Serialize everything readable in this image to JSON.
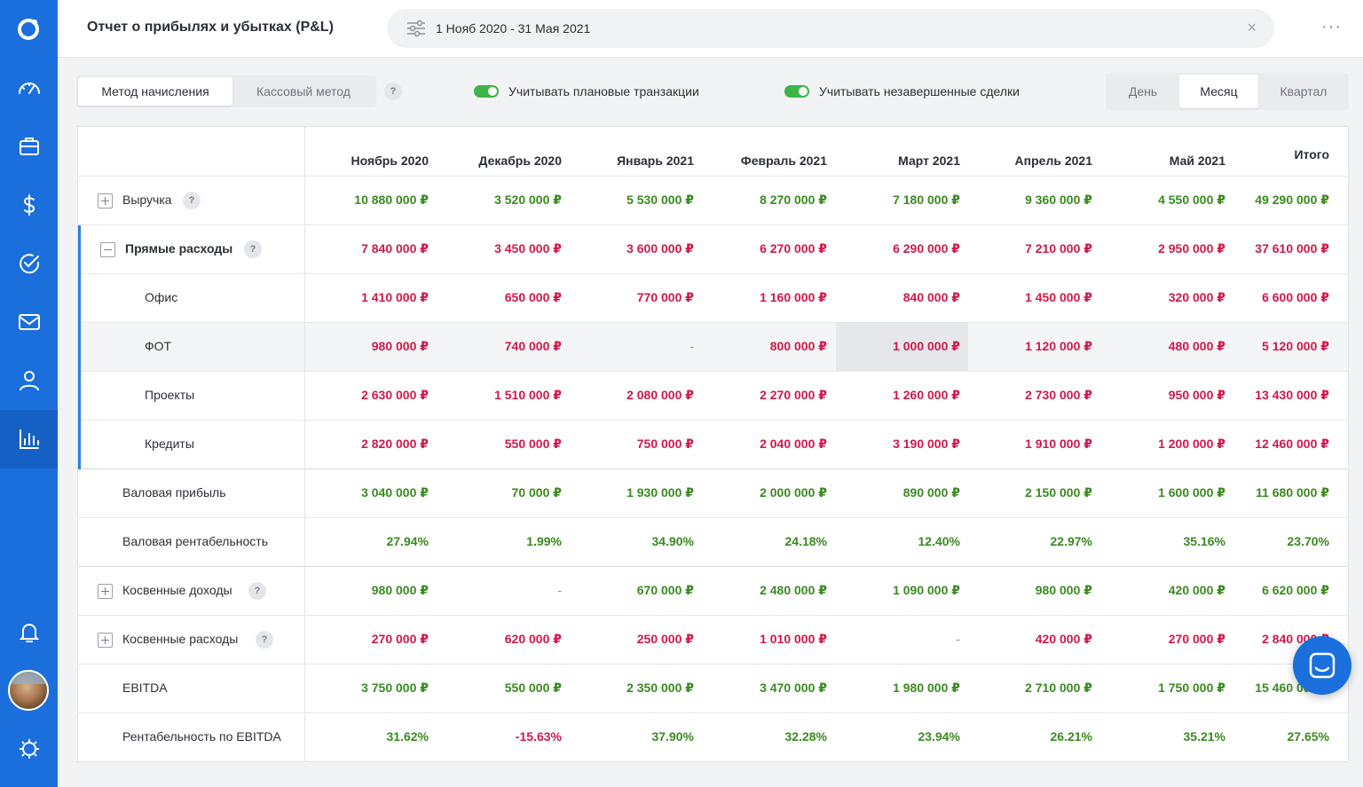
{
  "header": {
    "title": "Отчет о прибылях и убытках (P&L)",
    "date_range": "1 Нояб 2020 - 31 Мая 2021",
    "clear_icon": "×",
    "more_icon": "···"
  },
  "toolbar": {
    "method_accrual": "Метод начисления",
    "method_cash": "Кассовый метод",
    "help": "?",
    "toggle_planned": "Учитывать плановые транзакции",
    "toggle_unfinished": "Учитывать незавершенные сделки",
    "period_day": "День",
    "period_month": "Месяц",
    "period_quarter": "Квартал"
  },
  "colors": {
    "sidebar": "#1a6fdc",
    "positive": "#3a8a1f",
    "negative": "#d1184a",
    "toggle_on": "#3bb54a",
    "accent": "#2f7ee6"
  },
  "sidebar_icons": [
    "logo-icon",
    "dashboard-icon",
    "briefcase-icon",
    "dollar-icon",
    "check-circle-icon",
    "mail-icon",
    "user-icon",
    "chart-icon",
    "bell-icon",
    "avatar",
    "settings-icon"
  ],
  "table": {
    "columns": [
      "Ноябрь 2020",
      "Декабрь 2020",
      "Январь 2021",
      "Февраль 2021",
      "Март 2021",
      "Апрель 2021",
      "Май 2021",
      "Итого"
    ],
    "rows": [
      {
        "label": "Выручка",
        "values": [
          "10 880 000 ₽",
          "3 520 000 ₽",
          "5 530 000 ₽",
          "8 270 000 ₽",
          "7 180 000 ₽",
          "9 360 000 ₽",
          "4 550 000 ₽",
          "49 290 000 ₽"
        ]
      },
      {
        "label": "Прямые расходы",
        "values": [
          "7 840 000 ₽",
          "3 450 000 ₽",
          "3 600 000 ₽",
          "6 270 000 ₽",
          "6 290 000 ₽",
          "7 210 000 ₽",
          "2 950 000 ₽",
          "37 610 000 ₽"
        ]
      },
      {
        "label": "Офис",
        "values": [
          "1 410 000 ₽",
          "650 000 ₽",
          "770 000 ₽",
          "1 160 000 ₽",
          "840 000 ₽",
          "1 450 000 ₽",
          "320 000 ₽",
          "6 600 000 ₽"
        ]
      },
      {
        "label": "ФОТ",
        "values": [
          "980 000 ₽",
          "740 000 ₽",
          "-",
          "800 000 ₽",
          "1 000 000 ₽",
          "1 120 000 ₽",
          "480 000 ₽",
          "5 120 000 ₽"
        ]
      },
      {
        "label": "Проекты",
        "values": [
          "2 630 000 ₽",
          "1 510 000 ₽",
          "2 080 000 ₽",
          "2 270 000 ₽",
          "1 260 000 ₽",
          "2 730 000 ₽",
          "950 000 ₽",
          "13 430 000 ₽"
        ]
      },
      {
        "label": "Кредиты",
        "values": [
          "2 820 000 ₽",
          "550 000 ₽",
          "750 000 ₽",
          "2 040 000 ₽",
          "3 190 000 ₽",
          "1 910 000 ₽",
          "1 200 000 ₽",
          "12 460 000 ₽"
        ]
      },
      {
        "label": "Валовая прибыль",
        "values": [
          "3 040 000 ₽",
          "70 000 ₽",
          "1 930 000 ₽",
          "2 000 000 ₽",
          "890 000 ₽",
          "2 150 000 ₽",
          "1 600 000 ₽",
          "11 680 000 ₽"
        ]
      },
      {
        "label": "Валовая рентабельность",
        "values": [
          "27.94%",
          "1.99%",
          "34.90%",
          "24.18%",
          "12.40%",
          "22.97%",
          "35.16%",
          "23.70%"
        ]
      },
      {
        "label": "Косвенные доходы",
        "values": [
          "980 000 ₽",
          "-",
          "670 000 ₽",
          "2 480 000 ₽",
          "1 090 000 ₽",
          "980 000 ₽",
          "420 000 ₽",
          "6 620 000 ₽"
        ]
      },
      {
        "label": "Косвенные расходы",
        "values": [
          "270 000 ₽",
          "620 000 ₽",
          "250 000 ₽",
          "1 010 000 ₽",
          "-",
          "420 000 ₽",
          "270 000 ₽",
          "2 840 000 ₽"
        ]
      },
      {
        "label": "EBITDA",
        "values": [
          "3 750 000 ₽",
          "550 000 ₽",
          "2 350 000 ₽",
          "3 470 000 ₽",
          "1 980 000 ₽",
          "2 710 000 ₽",
          "1 750 000 ₽",
          "15 460 000 ₽"
        ]
      },
      {
        "label": "Рентабельность по EBITDA",
        "values": [
          "31.62%",
          "-15.63%",
          "37.90%",
          "32.28%",
          "23.94%",
          "26.21%",
          "35.21%",
          "27.65%"
        ]
      }
    ]
  }
}
